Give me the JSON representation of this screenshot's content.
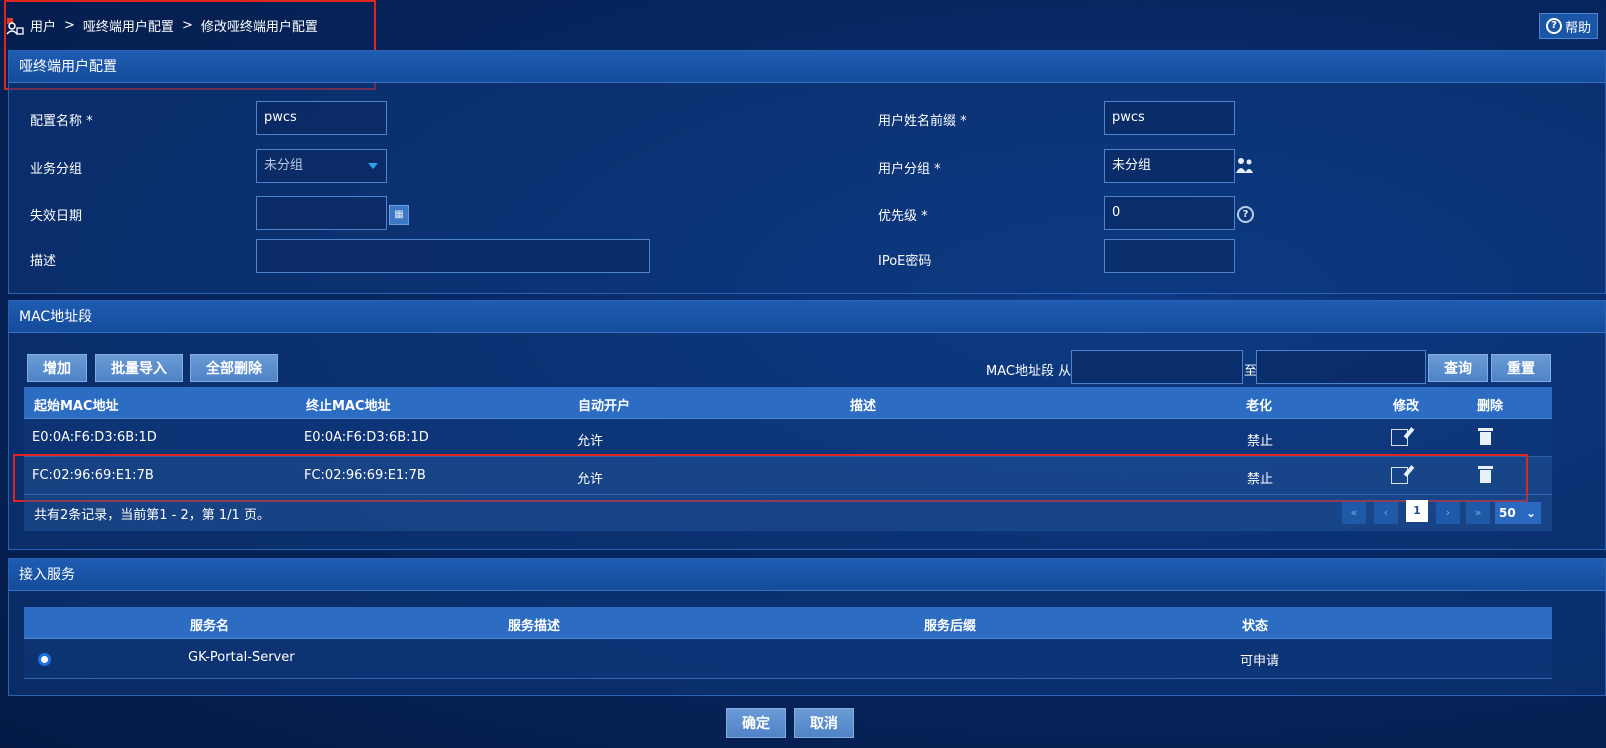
{
  "breadcrumb": {
    "items": [
      "用户",
      "哑终端用户配置",
      "修改哑终端用户配置"
    ],
    "separator": ">"
  },
  "help": {
    "label": "帮助"
  },
  "config_panel": {
    "title": "哑终端用户配置",
    "fields": {
      "config_name": {
        "label": "配置名称",
        "required": "*",
        "value": "pwcs"
      },
      "username_prefix": {
        "label": "用户姓名前缀",
        "required": "*",
        "value": "pwcs"
      },
      "business_group": {
        "label": "业务分组",
        "value": "未分组"
      },
      "user_group": {
        "label": "用户分组",
        "required": "*",
        "value": "未分组"
      },
      "expire_date": {
        "label": "失效日期",
        "value": ""
      },
      "priority": {
        "label": "优先级",
        "required": "*",
        "value": "0"
      },
      "description": {
        "label": "描述",
        "value": ""
      },
      "ipoe_password": {
        "label": "IPoE密码",
        "value": ""
      }
    }
  },
  "mac_panel": {
    "title": "MAC地址段",
    "buttons": {
      "add": "增加",
      "batch_import": "批量导入",
      "delete_all": "全部删除",
      "query": "查询",
      "reset": "重置"
    },
    "filter": {
      "label_from": "MAC地址段 从",
      "label_to": "至",
      "from_value": "",
      "to_value": ""
    },
    "columns": [
      "起始MAC地址",
      "终止MAC地址",
      "自动开户",
      "描述",
      "老化",
      "修改",
      "删除"
    ],
    "rows": [
      {
        "start_mac": "E0:0A:F6:D3:6B:1D",
        "end_mac": "E0:0A:F6:D3:6B:1D",
        "auto_open": "允许",
        "description": "",
        "aging": "禁止"
      },
      {
        "start_mac": "FC:02:96:69:E1:7B",
        "end_mac": "FC:02:96:69:E1:7B",
        "auto_open": "允许",
        "description": "",
        "aging": "禁止"
      }
    ],
    "summary": "共有2条记录，当前第1 - 2，第 1/1 页。",
    "pager": {
      "current_page": "1",
      "page_size": "50"
    }
  },
  "service_panel": {
    "title": "接入服务",
    "columns": [
      "服务名",
      "服务描述",
      "服务后缀",
      "状态"
    ],
    "rows": [
      {
        "name": "GK-Portal-Server",
        "description": "",
        "suffix": "",
        "status": "可申请",
        "selected": true
      }
    ]
  },
  "footer": {
    "confirm": "确定",
    "cancel": "取消"
  },
  "colors": {
    "accent": "#1f5aa8",
    "highlight": "#e0251f",
    "background": "#072762"
  },
  "icons": [
    "user-lock-icon",
    "help-icon",
    "dropdown-arrow-icon",
    "calendar-icon",
    "user-group-icon",
    "question-icon",
    "edit-icon",
    "trash-icon",
    "radio-selected-icon"
  ]
}
